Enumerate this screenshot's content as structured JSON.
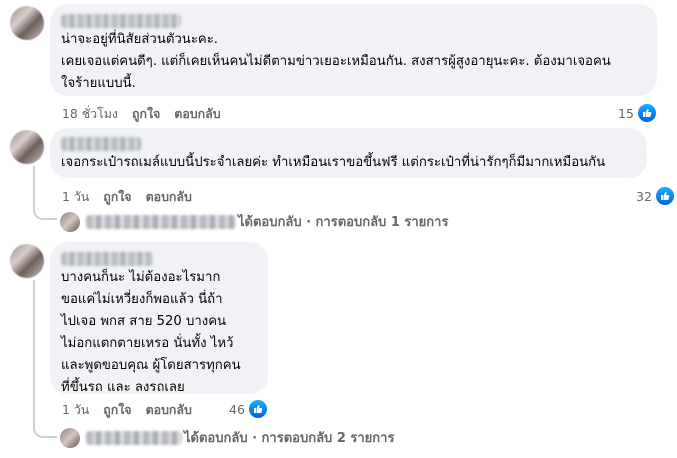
{
  "comments": [
    {
      "text": "น่าจะอยู่ที่นิสัยส่วนตัวนะคะ.\nเคยเจอแต่คนดีๆ. แต่ก็เคยเห็นคนไม่ดีตามข่าวเยอะเหมือนกัน. สงสารผู้สูงอายุนะคะ. ต้องมาเจอคน\nใจร้ายแบบนี้.",
      "time": "18 ชั่วโมง",
      "like": "ถูกใจ",
      "reply": "ตอบกลับ",
      "reactions": "15"
    },
    {
      "text": "เจอกระเป๋ารถเมล์แบบนี้ประจำเลยค่ะ ทำเหมือนเราขอขึ้นฟรี แต่กระเป๋าที่น่ารักๆก็มีมากเหมือนกัน",
      "time": "1 วัน",
      "like": "ถูกใจ",
      "reply": "ตอบกลับ",
      "reactions": "32",
      "replies_label": "ได้ตอบกลับ · การตอบกลับ 1 รายการ"
    },
    {
      "text": "บางคนก็นะ ไม่ต้องอะไรมาก\nขอแค่ไม่เหวี่ยงก็พอแล้ว นี่ถ้า\nไปเจอ พกส สาย 520 บางคน\nไม่อกแตกตายเหรอ นั่นทั้ง ไหว้\nและพูดขอบคุณ ผู้โดยสารทุกคน\nที่ขึ้นรถ และ ลงรถเลย",
      "time": "1 วัน",
      "like": "ถูกใจ",
      "reply": "ตอบกลับ",
      "reactions": "46",
      "replies_label": "ได้ตอบกลับ · การตอบกลับ 2 รายการ"
    }
  ],
  "icons": {
    "reaction": "like-thumb-icon"
  },
  "colors": {
    "like_blue": "#0866ff",
    "bubble": "#f0f2f5",
    "meta": "#65676b"
  }
}
